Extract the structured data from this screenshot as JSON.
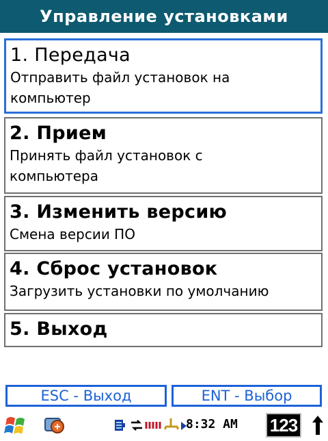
{
  "header": {
    "title": "Управление установками"
  },
  "menu": {
    "items": [
      {
        "title": "1. Передача",
        "desc_lines": [
          "Отправить файл установок на",
          "компьютер"
        ]
      },
      {
        "title": "2. Прием",
        "desc_lines": [
          "Принять файл установок с",
          "компьютера"
        ]
      },
      {
        "title": "3. Изменить версию",
        "desc_lines": [
          "Смена версии ПО"
        ]
      },
      {
        "title": "4. Сброс установок",
        "desc_lines": [
          "Загрузить установки по умолчанию"
        ]
      },
      {
        "title": "5. Выход",
        "desc_lines": []
      }
    ],
    "selected_index": 0
  },
  "footer": {
    "esc_label": "ESC - Выход",
    "ent_label": "ENT - Выбор"
  },
  "taskbar": {
    "time": "8:32 AM",
    "input_mode": "123",
    "icons": [
      "start-flag-icon",
      "sync-icon",
      "battery-icon",
      "network-icon",
      "volume-icon",
      "up-arrow-icon"
    ]
  },
  "colors": {
    "title_bg": "#0e5a70",
    "accent": "#1d62d8",
    "selected_border": "#2a6fd9"
  }
}
